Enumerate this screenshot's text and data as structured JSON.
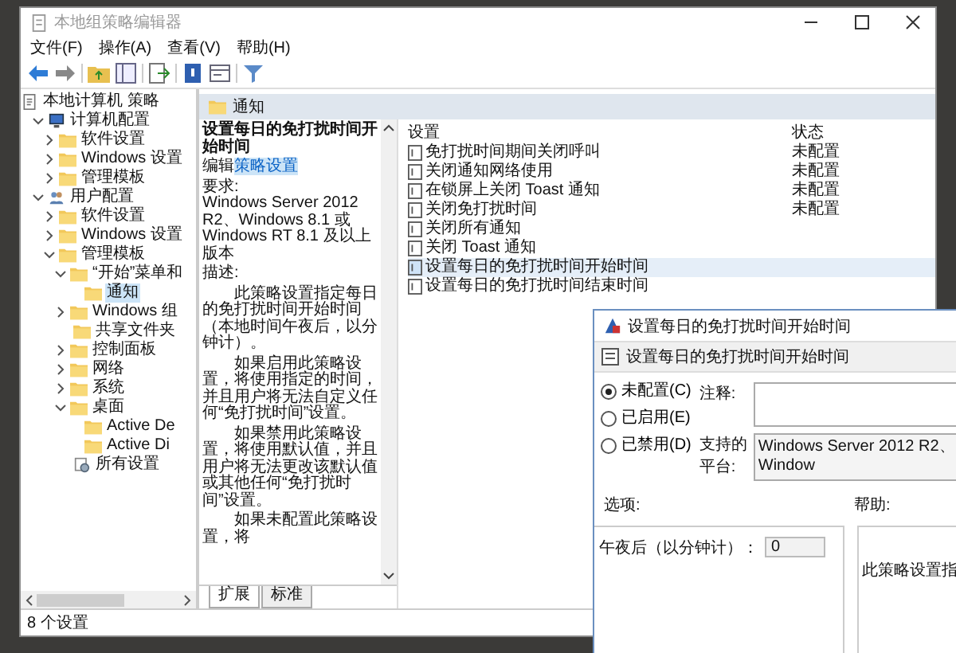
{
  "window": {
    "title": "本地组策略编辑器",
    "menu": [
      "文件(F)",
      "操作(A)",
      "查看(V)",
      "帮助(H)"
    ]
  },
  "tree": [
    {
      "label": "本地计算机 策略",
      "kind": "policy",
      "selected": false,
      "children": [
        {
          "label": "计算机配置",
          "kind": "computer",
          "selected": false,
          "expanded": true,
          "children": [
            {
              "label": "软件设置",
              "kind": "folder",
              "selected": false,
              "expanded": false
            },
            {
              "label": "Windows 设置",
              "kind": "folder",
              "selected": false,
              "expanded": false
            },
            {
              "label": "管理模板",
              "kind": "folder",
              "selected": false,
              "expanded": false
            }
          ]
        },
        {
          "label": "用户配置",
          "kind": "user",
          "selected": false,
          "expanded": true,
          "children": [
            {
              "label": "软件设置",
              "kind": "folder",
              "selected": false,
              "expanded": false
            },
            {
              "label": "Windows 设置",
              "kind": "folder",
              "selected": false,
              "expanded": false
            },
            {
              "label": "管理模板",
              "kind": "folder",
              "selected": false,
              "expanded": true,
              "children": [
                {
                  "label": "“开始”菜单和",
                  "kind": "folder",
                  "selected": false,
                  "expanded": true,
                  "children": [
                    {
                      "label": "通知",
                      "kind": "folder",
                      "selected": true
                    }
                  ]
                },
                {
                  "label": "Windows 组",
                  "kind": "folder",
                  "selected": false,
                  "expanded": false
                },
                {
                  "label": "共享文件夹",
                  "kind": "folder",
                  "selected": false
                },
                {
                  "label": "控制面板",
                  "kind": "folder",
                  "selected": false,
                  "expanded": false
                },
                {
                  "label": "网络",
                  "kind": "folder",
                  "selected": false,
                  "expanded": false
                },
                {
                  "label": "系统",
                  "kind": "folder",
                  "selected": false,
                  "expanded": false
                },
                {
                  "label": "桌面",
                  "kind": "folder",
                  "selected": false,
                  "expanded": true,
                  "children": [
                    {
                      "label": "Active De",
                      "kind": "folder",
                      "selected": false
                    },
                    {
                      "label": "Active Di",
                      "kind": "folder",
                      "selected": false
                    }
                  ]
                },
                {
                  "label": "所有设置",
                  "kind": "allsettings",
                  "selected": false
                }
              ]
            }
          ]
        }
      ]
    }
  ],
  "header": {
    "title": "通知"
  },
  "description": {
    "title": "设置每日的免打扰时间开始时间",
    "edit_prefix": "编辑",
    "edit_link": "策略设置",
    "requirements_label": "要求:",
    "requirements": "Windows Server 2012 R2、Windows 8.1 或 Windows RT 8.1 及以上版本",
    "description_label": "描述:",
    "paragraphs": [
      "此策略设置指定每日的免打扰时间开始时间（本地时间午夜后，以分钟计）。",
      "如果启用此策略设置，将使用指定的时间，并且用户将无法自定义任何“免打扰时间”设置。",
      "如果禁用此策略设置，将使用默认值，并且用户将无法更改该默认值或其他任何“免打扰时间”设置。",
      "如果未配置此策略设置，将"
    ]
  },
  "tabs": [
    {
      "label": "扩展",
      "selected": true
    },
    {
      "label": "标准",
      "selected": false
    }
  ],
  "list": {
    "columns": [
      "设置",
      "状态"
    ],
    "rows": [
      {
        "name": "免打扰时间期间关闭呼叫",
        "status": "未配置",
        "selected": false
      },
      {
        "name": "关闭通知网络使用",
        "status": "未配置",
        "selected": false
      },
      {
        "name": "在锁屏上关闭 Toast 通知",
        "status": "未配置",
        "selected": false
      },
      {
        "name": "关闭免打扰时间",
        "status": "未配置",
        "selected": false
      },
      {
        "name": "关闭所有通知",
        "selected": false
      },
      {
        "name": "关闭 Toast 通知",
        "selected": false
      },
      {
        "name": "设置每日的免打扰时间开始时间",
        "selected": true
      },
      {
        "name": "设置每日的免打扰时间结束时间",
        "selected": false
      }
    ]
  },
  "status_bar": "8 个设置",
  "dialog": {
    "title": "设置每日的免打扰时间开始时间",
    "setting": "设置每日的免打扰时间开始时间",
    "states": [
      {
        "label": "未配置(C)",
        "selected": true
      },
      {
        "label": "已启用(E)",
        "selected": false
      },
      {
        "label": "已禁用(D)",
        "selected": false
      }
    ],
    "comment_label": "注释:",
    "platform_label": "支持的平台:",
    "platform": "Windows Server 2012 R2、Window",
    "options_label": "选项:",
    "help_label": "帮助:",
    "option_field": {
      "label": "午夜后（以分钟计）：",
      "value": "0"
    },
    "help_text": "此策略设置指"
  }
}
